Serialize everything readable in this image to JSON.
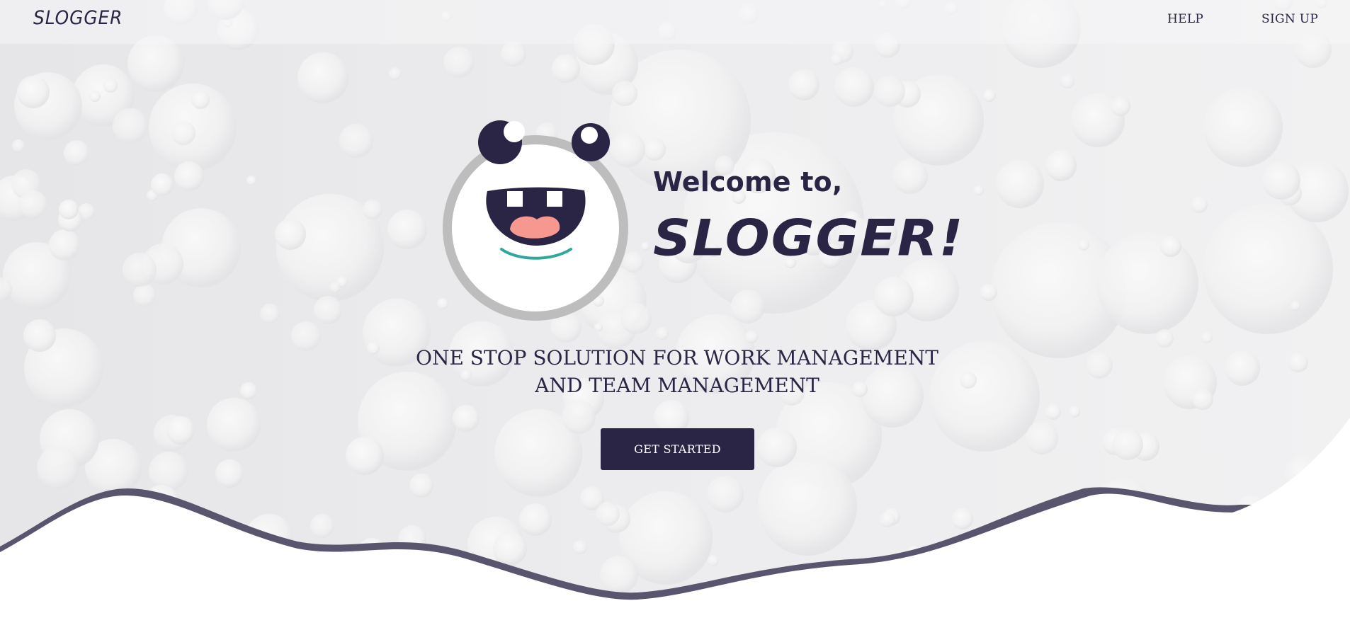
{
  "header": {
    "brand": "SLOGGER",
    "nav": {
      "help_label": "HELP",
      "signup_label": "SIGN UP"
    }
  },
  "hero": {
    "welcome": "Welcome to,",
    "app_name": "SLOGGER!",
    "tagline_line1": "ONE STOP SOLUTION FOR WORK MANAGEMENT",
    "tagline_line2": "AND TEAM MANAGEMENT",
    "cta_label": "GET STARTED"
  },
  "icons": {
    "mascot": "smiling-mascot-face-icon"
  },
  "colors": {
    "primary": "#2b2545",
    "wave": "#5a556f",
    "background": "#ebebed",
    "mouth_tongue": "#f6988f",
    "smile_line": "#2fa89c"
  }
}
